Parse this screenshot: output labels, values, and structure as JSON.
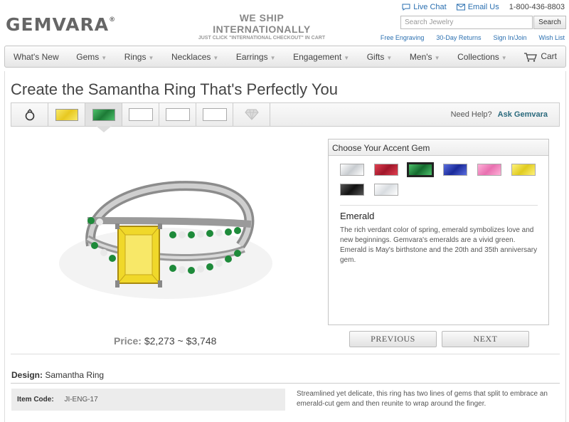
{
  "brand": {
    "name": "GEMVARA",
    "mark": "®"
  },
  "shipping": {
    "line1": "WE SHIP INTERNATIONALLY",
    "line2": "JUST CLICK \"INTERNATIONAL CHECKOUT\" IN CART"
  },
  "top_links": {
    "live_chat": "Live Chat",
    "email": "Email Us",
    "phone": "1-800-436-8803"
  },
  "search": {
    "placeholder": "Search Jewelry",
    "button": "Search"
  },
  "sub_links": [
    "Free Engraving",
    "30-Day Returns",
    "Sign In/Join",
    "Wish List"
  ],
  "nav": {
    "items": [
      {
        "label": "What's New",
        "caret": false
      },
      {
        "label": "Gems",
        "caret": true
      },
      {
        "label": "Rings",
        "caret": true
      },
      {
        "label": "Necklaces",
        "caret": true
      },
      {
        "label": "Earrings",
        "caret": true
      },
      {
        "label": "Engagement",
        "caret": true
      },
      {
        "label": "Gifts",
        "caret": true
      },
      {
        "label": "Men's",
        "caret": true
      },
      {
        "label": "Collections",
        "caret": true
      }
    ],
    "cart": "Cart"
  },
  "page_title": "Create the Samantha Ring That's Perfectly You",
  "steps": {
    "center_stone_color": "#f2dc3a",
    "accent_stone_color": "#2a9a4a",
    "need_help": "Need Help?",
    "ask": "Ask Gemvara"
  },
  "accent": {
    "title": "Choose Your Accent Gem",
    "gems": [
      {
        "name": "Diamond",
        "color": "#e8ecef"
      },
      {
        "name": "Ruby",
        "color": "#c0243a"
      },
      {
        "name": "Emerald",
        "color": "#1f8a3e",
        "selected": true
      },
      {
        "name": "Sapphire",
        "color": "#2a3fb8"
      },
      {
        "name": "Pink Sapphire",
        "color": "#f08ac0"
      },
      {
        "name": "Yellow Sapphire",
        "color": "#f0de3a"
      },
      {
        "name": "Black Diamond",
        "color": "#2a2a2a"
      },
      {
        "name": "White Sapphire",
        "color": "#eef0f2"
      }
    ],
    "selected_name": "Emerald",
    "description": "The rich verdant color of spring, emerald symbolizes love and new beginnings. Gemvara's emeralds are a vivid green. Emerald is May's birthstone and the 20th and 35th anniversary gem."
  },
  "buttons": {
    "previous": "PREVIOUS",
    "next": "NEXT"
  },
  "price": {
    "label": "Price:",
    "value": "$2,273 ~ $3,748"
  },
  "design": {
    "label": "Design:",
    "value": "Samantha Ring"
  },
  "item_code": {
    "label": "Item Code:",
    "value": "JI-ENG-17"
  },
  "product_description": "Streamlined yet delicate, this ring has two lines of gems that split to embrace an emerald-cut gem and then reunite to wrap around the finger."
}
